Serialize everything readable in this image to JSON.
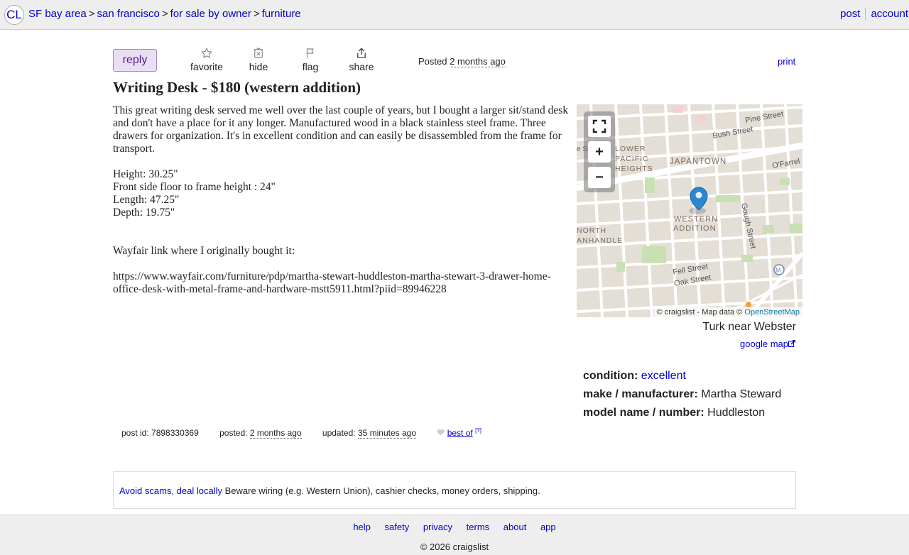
{
  "header": {
    "logo": "CL",
    "breadcrumbs": [
      "SF bay area",
      "san francisco",
      "for sale by owner",
      "furniture"
    ],
    "separator": ">",
    "post_label": "post",
    "account_label": "account"
  },
  "actions": {
    "reply_label": "reply",
    "favorite_label": "favorite",
    "hide_label": "hide",
    "flag_label": "flag",
    "share_label": "share",
    "posted_prefix": "Posted",
    "posted_time": "2 months ago",
    "print_label": "print"
  },
  "listing": {
    "title": "Writing Desk - $180 (western addition)",
    "body_paragraph": "This great writing desk served me well over the last couple of years, but I bought a larger sit/stand desk and don't have a place for it any longer. Manufactured wood in a black stainless steel frame. Three drawers for organization. It's in excellent condition and can easily be disassembled from the frame for transport.",
    "dims": [
      "Height: 30.25\"",
      "Front side floor to frame height : 24\"",
      "Length: 47.25\"",
      "Depth: 19.75\""
    ],
    "link_intro": "Wayfair link where I originally bought it:",
    "link_url": "https://www.wayfair.com/furniture/pdp/martha-stewart-huddleston-martha-stewart-3-drawer-home-office-desk-with-metal-frame-and-hardware-mstt5911.html?piid=89946228"
  },
  "map": {
    "labels": {
      "pine": "Pine Street",
      "bush": "Bush Street",
      "ofarrell": "O'Farrel",
      "japantown": "JAPANTOWN",
      "lower": "LOWER",
      "pacific": "PACIFIC",
      "heights": "HEIGHTS",
      "st": "e Stre",
      "western": "WESTERN",
      "addition": "ADDITION",
      "north": "NORTH",
      "panhandle": "ANHANDLE",
      "gough": "Gough Street",
      "fell": "Fell Street",
      "oak": "Oak Street",
      "metro": "M"
    },
    "attribution_prefix": "© craigslist - Map data ©",
    "attribution_link": "OpenStreetMap",
    "zoom_in": "+",
    "zoom_out": "−"
  },
  "location": {
    "text": "Turk near Webster",
    "google_map_label": "google map"
  },
  "attributes": [
    {
      "key": "condition:",
      "value": "excellent"
    },
    {
      "key": "make / manufacturer:",
      "value": "Martha Steward"
    },
    {
      "key": "model name / number:",
      "value": "Huddleston"
    }
  ],
  "postinfo": {
    "post_id_label": "post id: 7898330369",
    "posted_label": "posted:",
    "posted_time": "2 months ago",
    "updated_label": "updated:",
    "updated_time": "35 minutes ago",
    "bestof_label": "best of",
    "bestof_help": "[?]"
  },
  "scam_notice": {
    "link": "Avoid scams, deal locally",
    "text": " Beware wiring (e.g. Western Union), cashier checks, money orders, shipping."
  },
  "footer": {
    "links": [
      "help",
      "safety",
      "privacy",
      "terms",
      "about",
      "app"
    ],
    "copyright": "© 2026 craigslist"
  }
}
